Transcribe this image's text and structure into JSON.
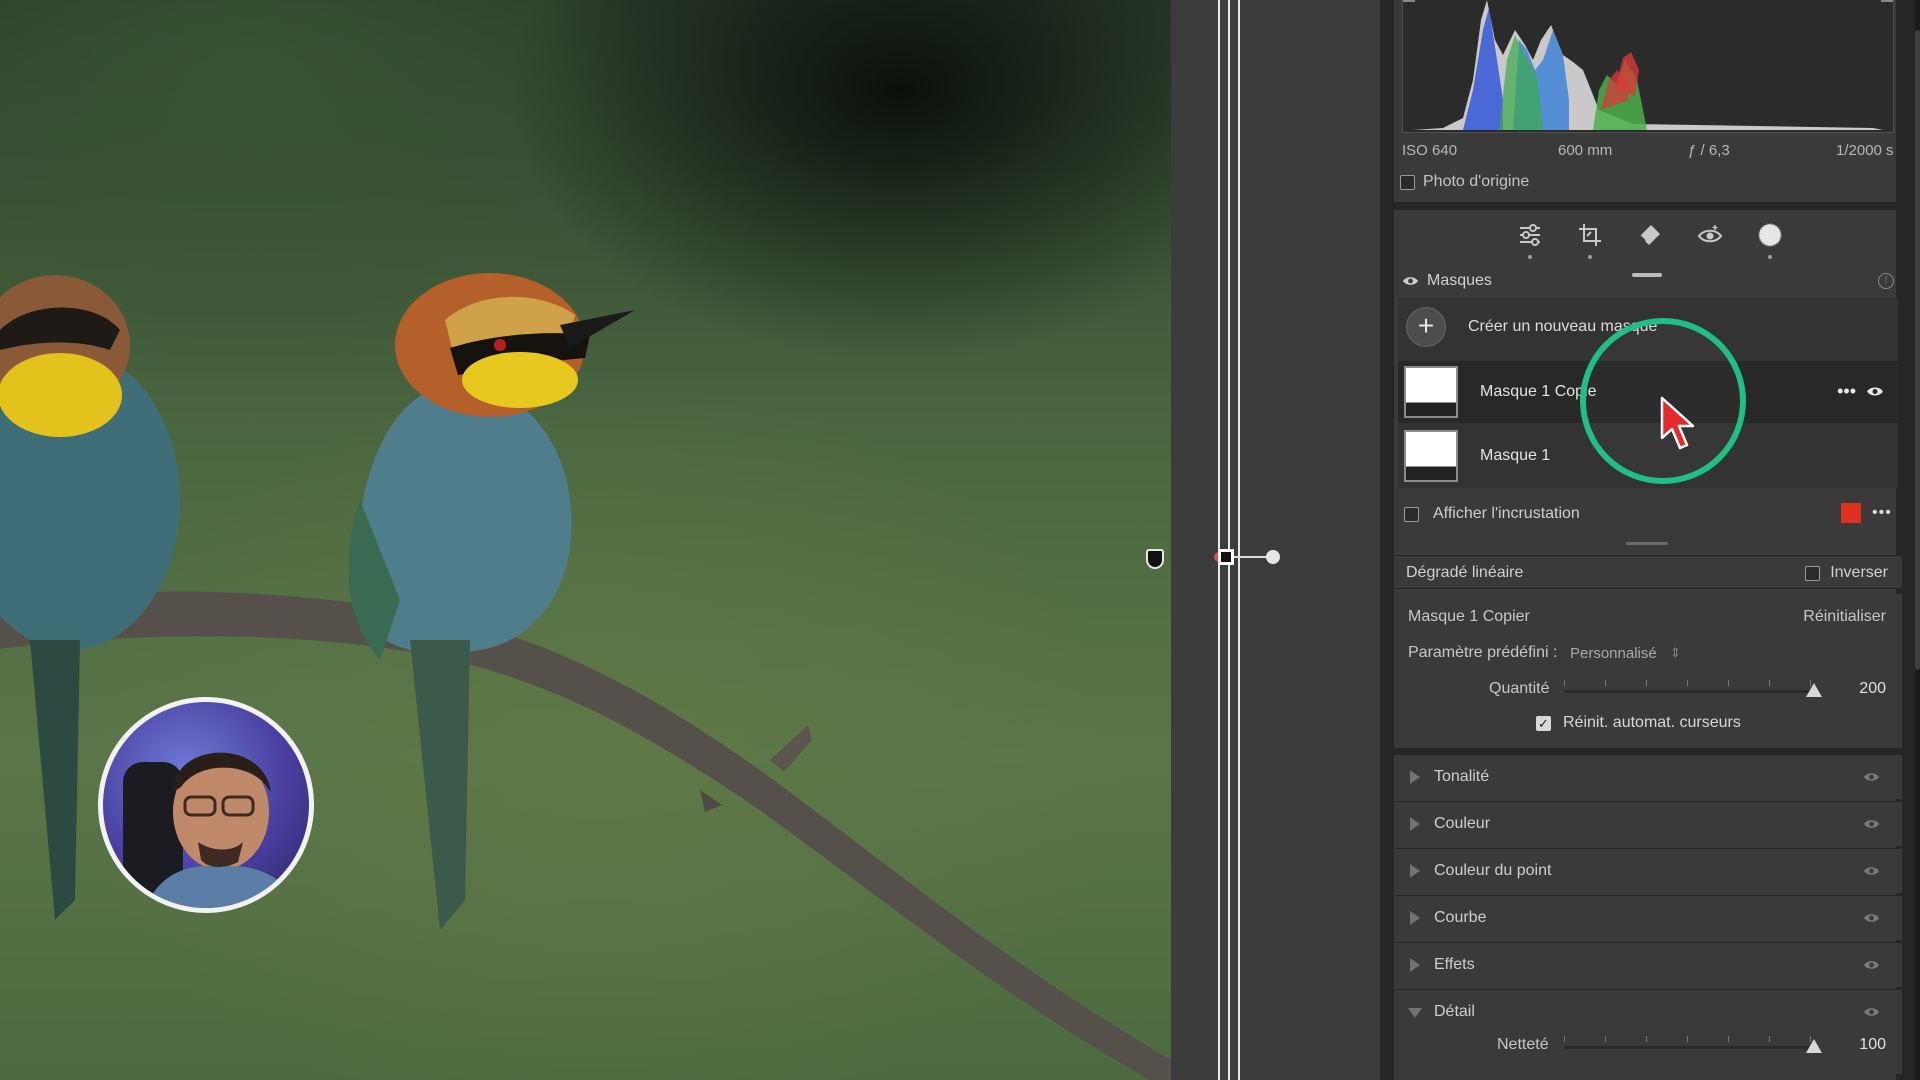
{
  "histogram": {
    "iso": "ISO 640",
    "focal": "600 mm",
    "aperture": "ƒ / 6,3",
    "shutter": "1/2000 s",
    "original_photo_label": "Photo d'origine"
  },
  "toolbar": {
    "icons": [
      "edit-sliders-icon",
      "crop-icon",
      "healing-eraser-icon",
      "red-eye-icon",
      "masking-icon"
    ]
  },
  "masks": {
    "header": "Masques",
    "create_new": "Créer un nouveau masque",
    "items": [
      {
        "name": "Masque 1 Copie",
        "selected": true
      },
      {
        "name": "Masque 1",
        "selected": false
      }
    ],
    "overlay_label": "Afficher l'incrustation",
    "overlay_color": "#e0301e"
  },
  "component": {
    "name": "Dégradé linéaire",
    "invert_label": "Inverser"
  },
  "properties": {
    "mask_name": "Masque 1 Copier",
    "reset_label": "Réinitialiser",
    "preset_label": "Paramètre prédéfini :",
    "preset_value": "Personnalisé",
    "preset_arrows": "⇕",
    "amount_label": "Quantité",
    "amount_value": "200",
    "amount_fraction": 1.0,
    "auto_reset_label": "Réinit. automat. curseurs",
    "auto_reset_checked": true
  },
  "groups": [
    {
      "label": "Tonalité",
      "open": false
    },
    {
      "label": "Couleur",
      "open": false
    },
    {
      "label": "Couleur du point",
      "open": false
    },
    {
      "label": "Courbe",
      "open": false
    },
    {
      "label": "Effets",
      "open": false
    },
    {
      "label": "Détail",
      "open": true
    }
  ],
  "detail": {
    "sharpness_label": "Netteté",
    "sharpness_value": "100",
    "sharpness_fraction": 1.0
  },
  "colors": {
    "click_ring": "#1fbf86",
    "panel_bg": "#3a3a3a"
  }
}
